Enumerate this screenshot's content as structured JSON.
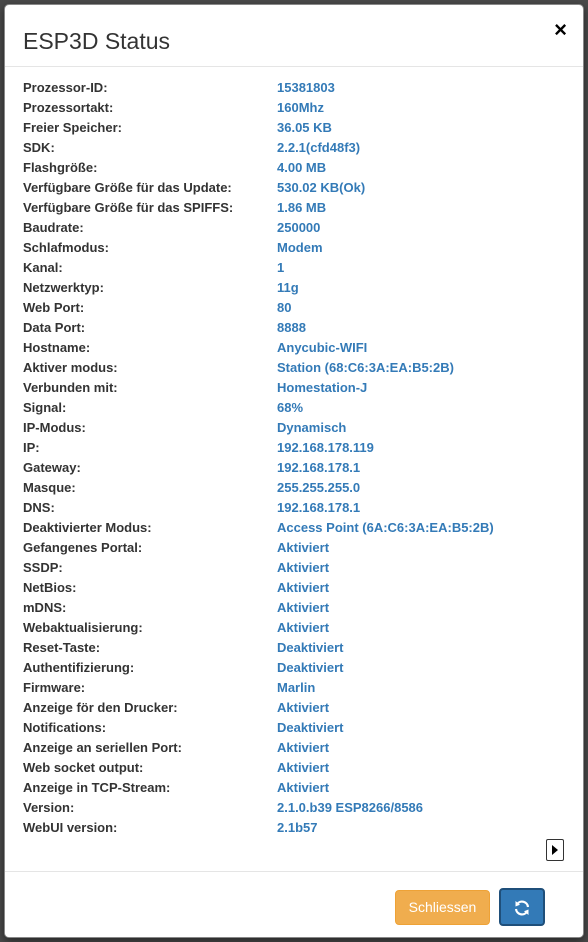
{
  "dialog": {
    "title": "ESP3D Status",
    "close_glyph": "×"
  },
  "status_rows": [
    {
      "label": "Prozessor-ID:",
      "value": "15381803"
    },
    {
      "label": "Prozessortakt:",
      "value": "160Mhz"
    },
    {
      "label": "Freier Speicher:",
      "value": "36.05 KB"
    },
    {
      "label": "SDK:",
      "value": "2.2.1(cfd48f3)"
    },
    {
      "label": "Flashgröße:",
      "value": "4.00 MB"
    },
    {
      "label": "Verfügbare Größe für das Update:",
      "value": "530.02 KB(Ok)"
    },
    {
      "label": "Verfügbare Größe für das SPIFFS:",
      "value": "1.86 MB"
    },
    {
      "label": "Baudrate:",
      "value": "250000"
    },
    {
      "label": "Schlafmodus:",
      "value": "Modem"
    },
    {
      "label": "Kanal:",
      "value": "1"
    },
    {
      "label": "Netzwerktyp:",
      "value": "11g"
    },
    {
      "label": "Web Port:",
      "value": "80"
    },
    {
      "label": "Data Port:",
      "value": "8888"
    },
    {
      "label": "Hostname:",
      "value": "Anycubic-WIFI"
    },
    {
      "label": "Aktiver modus:",
      "value": "Station (68:C6:3A:EA:B5:2B)"
    },
    {
      "label": "Verbunden mit:",
      "value": "Homestation-J"
    },
    {
      "label": "Signal:",
      "value": "68%"
    },
    {
      "label": "IP-Modus:",
      "value": "Dynamisch"
    },
    {
      "label": "IP:",
      "value": "192.168.178.119"
    },
    {
      "label": "Gateway:",
      "value": "192.168.178.1"
    },
    {
      "label": "Masque:",
      "value": "255.255.255.0"
    },
    {
      "label": "DNS:",
      "value": "192.168.178.1"
    },
    {
      "label": "Deaktivierter Modus:",
      "value": "Access Point (6A:C6:3A:EA:B5:2B)"
    },
    {
      "label": "Gefangenes Portal:",
      "value": "Aktiviert"
    },
    {
      "label": "SSDP:",
      "value": "Aktiviert"
    },
    {
      "label": "NetBios:",
      "value": "Aktiviert"
    },
    {
      "label": "mDNS:",
      "value": "Aktiviert"
    },
    {
      "label": "Webaktualisierung:",
      "value": "Aktiviert"
    },
    {
      "label": "Reset-Taste:",
      "value": "Deaktiviert"
    },
    {
      "label": "Authentifizierung:",
      "value": "Deaktiviert"
    },
    {
      "label": "Firmware:",
      "value": "Marlin"
    },
    {
      "label": "Anzeige för den Drucker:",
      "value": "Aktiviert"
    },
    {
      "label": "Notifications:",
      "value": "Deaktiviert"
    },
    {
      "label": "Anzeige an seriellen Port:",
      "value": "Aktiviert"
    },
    {
      "label": "Web socket output:",
      "value": "Aktiviert"
    },
    {
      "label": "Anzeige in TCP-Stream:",
      "value": "Aktiviert"
    },
    {
      "label": "Version:",
      "value": "2.1.0.b39 ESP8266/8586"
    },
    {
      "label": "WebUI version:",
      "value": "2.1b57"
    }
  ],
  "footer": {
    "close_label": "Schliessen",
    "refresh_icon": "refresh-icon"
  },
  "colors": {
    "value_text": "#337ab7",
    "label_text": "#333333",
    "close_button": "#f0ad4e",
    "refresh_button": "#337ab7"
  }
}
